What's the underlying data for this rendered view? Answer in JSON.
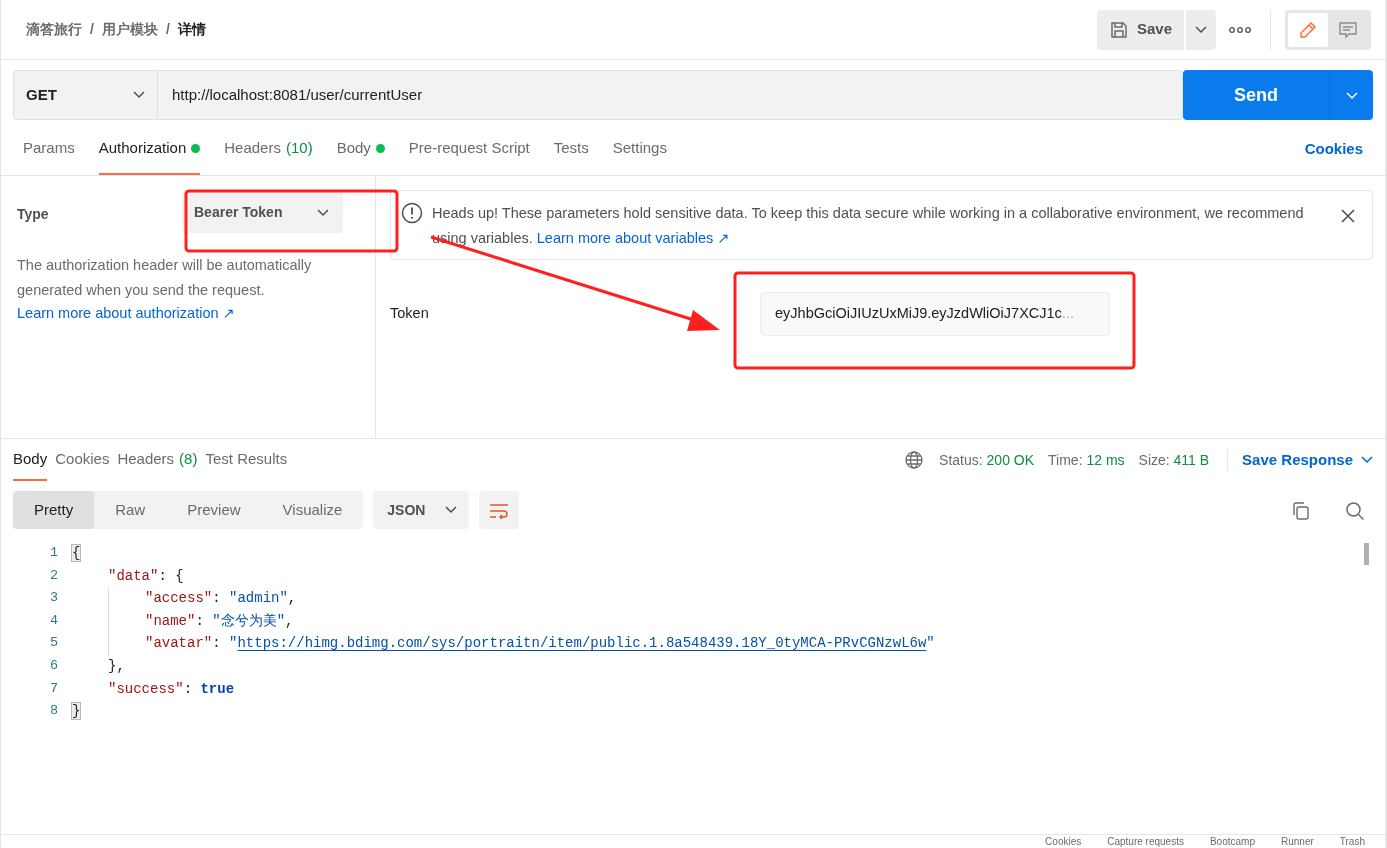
{
  "breadcrumb": [
    {
      "kind": "crumb",
      "text": "滴答旅行",
      "selected": false
    },
    {
      "kind": "separator",
      "text": "/"
    },
    {
      "kind": "crumb",
      "text": "用户模块",
      "selected": false
    },
    {
      "kind": "separator",
      "text": "/"
    },
    {
      "kind": "crumb",
      "text": "详情",
      "selected": true
    }
  ],
  "header_actions": {
    "save": "Save",
    "view_toggle": [
      {
        "kind": "edit",
        "selected": true
      },
      {
        "kind": "comments",
        "selected": false
      }
    ]
  },
  "request": {
    "method": "GET",
    "url": "http://localhost:8081/user/currentUser",
    "send": "Send"
  },
  "request_tabs": [
    {
      "label": "Params",
      "selected": false,
      "dot": false
    },
    {
      "label": "Authorization",
      "selected": true,
      "dot": true
    },
    {
      "label": "Headers",
      "count": "(10)",
      "selected": false,
      "dot": false
    },
    {
      "label": "Body",
      "selected": false,
      "dot": true
    },
    {
      "label": "Pre-request Script",
      "selected": false,
      "dot": false
    },
    {
      "label": "Tests",
      "selected": false,
      "dot": false
    },
    {
      "label": "Settings",
      "selected": false,
      "dot": false
    }
  ],
  "cookies_link": "Cookies",
  "auth": {
    "type_label": "Type",
    "type_value": "Bearer Token",
    "description": "The authorization header will be automatically generated when you send the request.",
    "learn_link": "Learn more about authorization ↗",
    "notice": {
      "text": "Heads up! These parameters hold sensitive data. To keep this data secure while working in a collaborative environment, we recommend using variables.",
      "link": "Learn more about variables ↗"
    },
    "token_label": "Token",
    "token_value": "eyJhbGciOiJIUzUxMiJ9.eyJzdWliOiJ7XCJ1c",
    "token_ellipsis": "..."
  },
  "response": {
    "tabs": [
      {
        "label": "Body",
        "selected": true
      },
      {
        "label": "Cookies",
        "selected": false
      },
      {
        "label": "Headers",
        "count": "(8)",
        "selected": false
      },
      {
        "label": "Test Results",
        "selected": false
      }
    ],
    "stats": [
      {
        "label": "Status:",
        "value": "200 OK"
      },
      {
        "label": "Time:",
        "value": "12 ms"
      },
      {
        "label": "Size:",
        "value": "411 B"
      }
    ],
    "save_response": "Save Response",
    "view_modes": [
      {
        "label": "Pretty",
        "selected": true
      },
      {
        "label": "Raw",
        "selected": false
      },
      {
        "label": "Preview",
        "selected": false
      },
      {
        "label": "Visualize",
        "selected": false
      }
    ],
    "format": "JSON",
    "code": [
      {
        "number": "1",
        "tokens": [
          {
            "kind": "bracket",
            "text": "{"
          }
        ]
      },
      {
        "number": "2",
        "tokens": [
          {
            "kind": "key",
            "text": "\"data\""
          },
          {
            "kind": "punct",
            "text": ": {"
          }
        ]
      },
      {
        "number": "3",
        "tokens": [
          {
            "kind": "key",
            "text": "\"access\""
          },
          {
            "kind": "punct",
            "text": ": "
          },
          {
            "kind": "string",
            "text": "\"admin\""
          },
          {
            "kind": "punct",
            "text": ","
          }
        ]
      },
      {
        "number": "4",
        "tokens": [
          {
            "kind": "key",
            "text": "\"name\""
          },
          {
            "kind": "punct",
            "text": ": "
          },
          {
            "kind": "string",
            "text": "\"念兮为美\""
          },
          {
            "kind": "punct",
            "text": ","
          }
        ]
      },
      {
        "number": "5",
        "tokens": [
          {
            "kind": "key",
            "text": "\"avatar\""
          },
          {
            "kind": "punct",
            "text": ": "
          },
          {
            "kind": "string",
            "text": "\""
          },
          {
            "kind": "link",
            "text": "https://himg.bdimg.com/sys/portraitn/item/public.1.8a548439.18Y_0tyMCA-PRvCGNzwL6w"
          },
          {
            "kind": "string",
            "text": "\""
          }
        ]
      },
      {
        "number": "6",
        "tokens": [
          {
            "kind": "punct",
            "text": "},"
          }
        ]
      },
      {
        "number": "7",
        "tokens": [
          {
            "kind": "key",
            "text": "\"success\""
          },
          {
            "kind": "punct",
            "text": ": "
          },
          {
            "kind": "bool",
            "text": "true"
          }
        ]
      },
      {
        "number": "8",
        "tokens": [
          {
            "kind": "bracket",
            "text": "}"
          }
        ]
      }
    ]
  },
  "footer": [
    "Cookies",
    "Capture requests",
    "Bootcamp",
    "Runner",
    "Trash"
  ]
}
